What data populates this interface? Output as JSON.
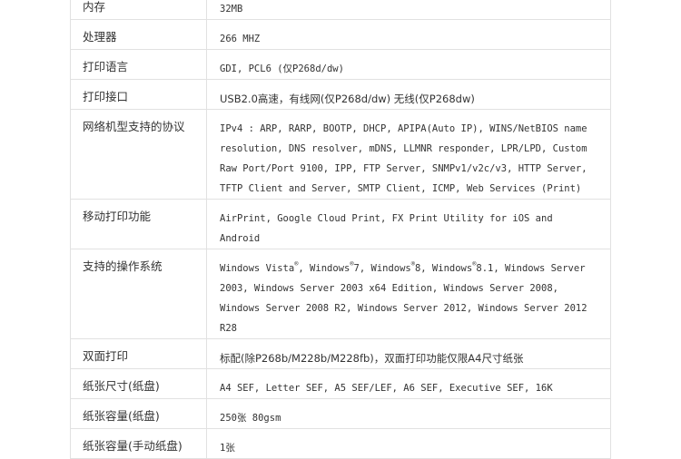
{
  "rows": [
    {
      "label": "内存",
      "value": "32MB"
    },
    {
      "label": "处理器",
      "value": "266 MHZ"
    },
    {
      "label": "打印语言",
      "value": "GDI, PCL6 (仅P268d/dw)"
    },
    {
      "label": "打印接口",
      "value": "USB2.0高速，有线网(仅P268d/dw) 无线(仅P268dw)"
    },
    {
      "label": "网络机型支持的协议",
      "value": "IPv4 : ARP, RARP, BOOTP, DHCP, APIPA(Auto IP), WINS/NetBIOS name resolution, DNS resolver, mDNS, LLMNR responder, LPR/LPD, Custom Raw Port/Port 9100, IPP, FTP Server, SNMPv1/v2c/v3, HTTP Server, TFTP Client and Server, SMTP Client, ICMP, Web Services (Print)"
    },
    {
      "label": "移动打印功能",
      "value": "AirPrint, Google Cloud Print, FX Print Utility for iOS and Android"
    },
    {
      "label": "支持的操作系统",
      "value_parts": [
        "Windows Vista",
        ", Windows",
        "7, Windows",
        "8, Windows",
        "8.1, Windows Server 2003, Windows Server 2003 x64 Edition, Windows Server 2008, Windows Server 2008 R2, Windows Server 2012, Windows Server 2012 R28"
      ],
      "reg_mark": "®"
    },
    {
      "label": "双面打印",
      "value": "标配(除P268b/M228b/M228fb)，双面打印功能仅限A4尺寸纸张"
    },
    {
      "label": "纸张尺寸(纸盘)",
      "value": "A4 SEF, Letter SEF, A5 SEF/LEF, A6 SEF, Executive SEF, 16K"
    },
    {
      "label": "纸张容量(纸盘)",
      "value": "250张 80gsm"
    },
    {
      "label": "纸张容量(手动纸盘)",
      "value": "1张"
    }
  ]
}
